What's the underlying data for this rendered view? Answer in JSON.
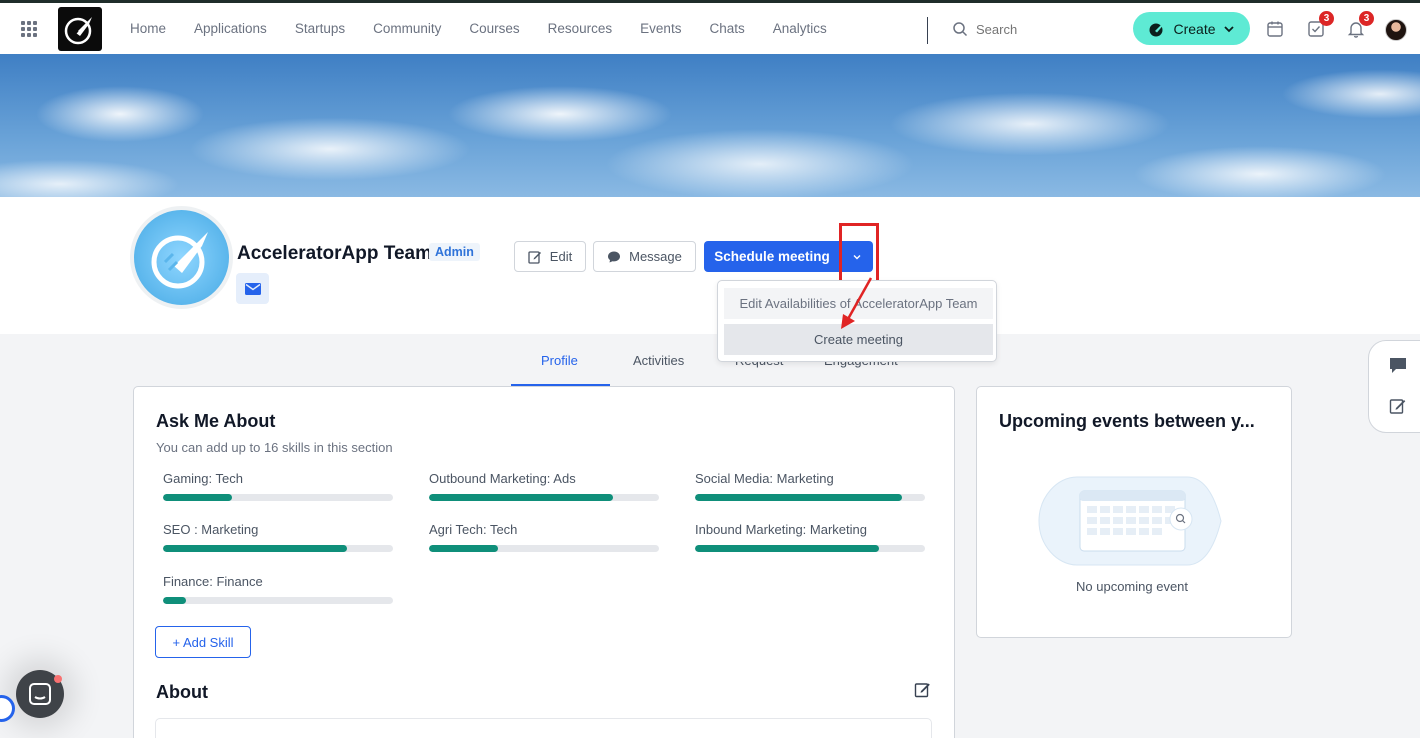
{
  "nav": {
    "items": [
      "Home",
      "Applications",
      "Startups",
      "Community",
      "Courses",
      "Resources",
      "Events",
      "Chats",
      "Analytics"
    ],
    "search_placeholder": "Search",
    "create_label": "Create",
    "tasks_badge": "3",
    "notifications_badge": "3"
  },
  "profile": {
    "name": "AcceleratorApp Team",
    "role_badge": "Admin",
    "edit_label": "Edit",
    "message_label": "Message",
    "schedule_label": "Schedule meeting"
  },
  "schedule_menu": {
    "items": [
      "Edit Availabilities of AcceleratorApp Team",
      "Create meeting"
    ]
  },
  "tabs": [
    "Profile",
    "Activities",
    "Request",
    "Engagement"
  ],
  "ask_me_about": {
    "title": "Ask Me About",
    "subtitle": "You can add up to 16 skills in this section",
    "skills": [
      {
        "label": "Gaming: Tech",
        "level": 0.3
      },
      {
        "label": "Outbound Marketing: Ads",
        "level": 0.8
      },
      {
        "label": "Social Media: Marketing",
        "level": 0.9
      },
      {
        "label": "SEO : Marketing",
        "level": 0.8
      },
      {
        "label": "Agri Tech: Tech",
        "level": 0.3
      },
      {
        "label": "Inbound Marketing: Marketing",
        "level": 0.8
      },
      {
        "label": "Finance: Finance",
        "level": 0.1
      }
    ],
    "add_skill_label": "+ Add Skill"
  },
  "about": {
    "title": "About"
  },
  "upcoming": {
    "title": "Upcoming events between y...",
    "empty_text": "No upcoming event"
  },
  "colors": {
    "primary": "#2563eb",
    "create_accent": "#5eead4",
    "skill_fill": "#0f8f7a",
    "badge": "#dc2626",
    "annotation": "#e02424"
  }
}
